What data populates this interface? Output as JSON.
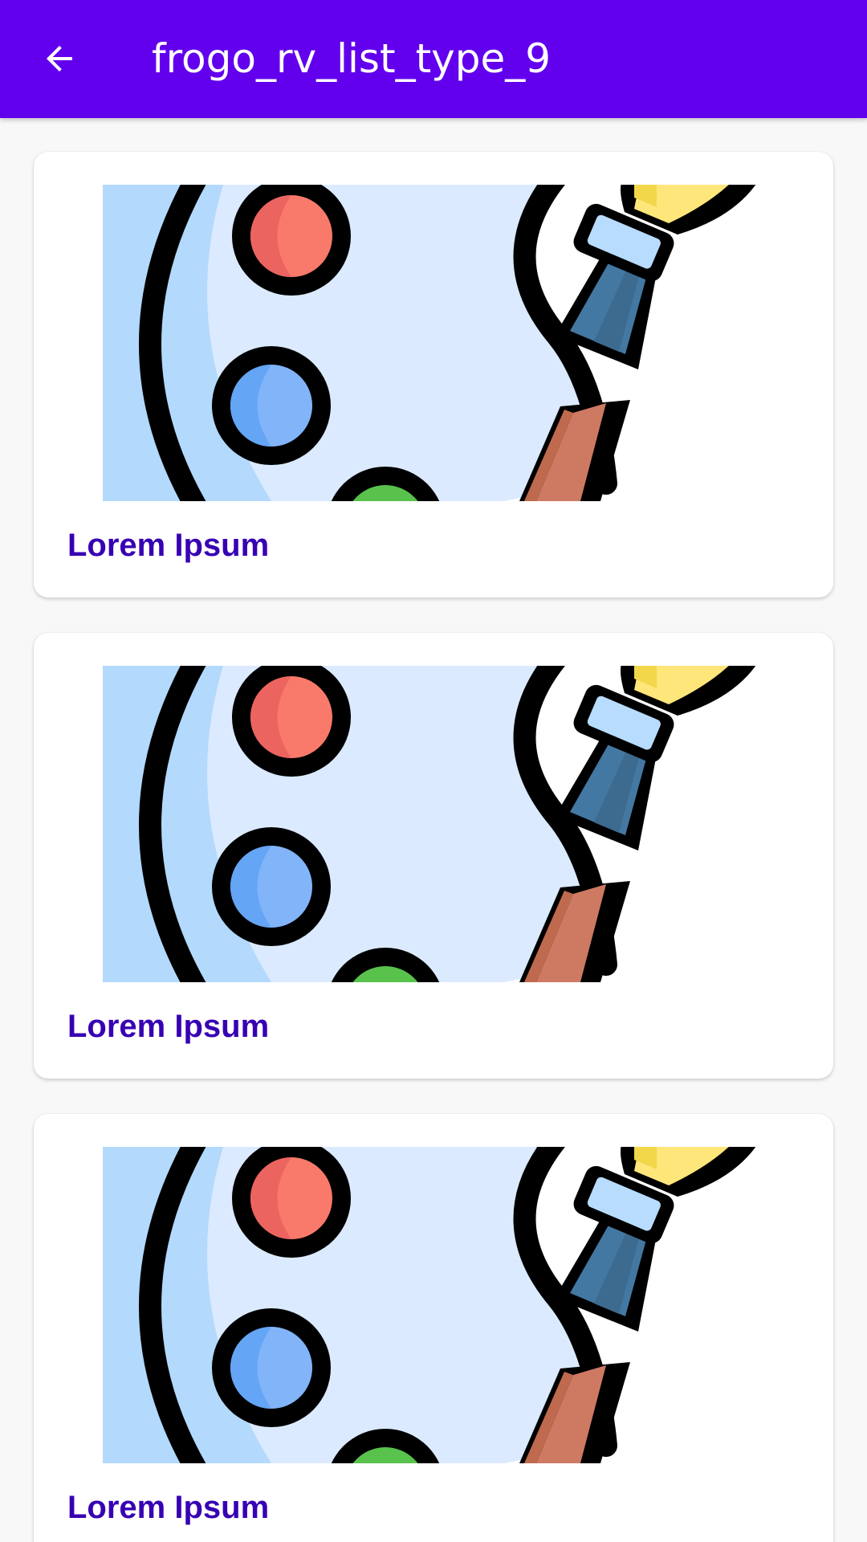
{
  "app_bar": {
    "title": "frogo_rv_list_type_9",
    "back_icon": "arrow-back-icon",
    "background_color": "#6200ee"
  },
  "list": {
    "items": [
      {
        "label": "Lorem Ipsum",
        "image_icon": "paint-palette-brush-image"
      },
      {
        "label": "Lorem Ipsum",
        "image_icon": "paint-palette-brush-image"
      },
      {
        "label": "Lorem Ipsum",
        "image_icon": "paint-palette-brush-image"
      }
    ],
    "label_color": "#3700b3"
  }
}
